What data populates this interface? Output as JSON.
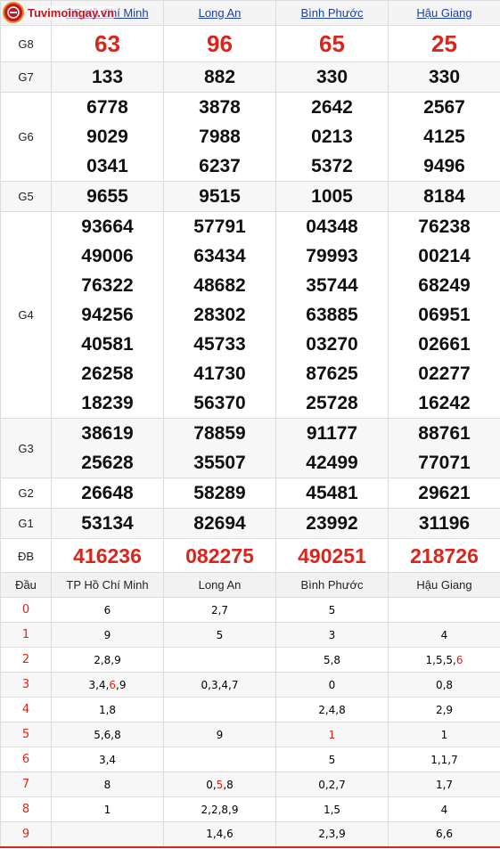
{
  "logo": {
    "text": "Tuvimoingay.vn"
  },
  "provinces": [
    "TP Hồ Chí Minh",
    "Long An",
    "Bình Phước",
    "Hậu Giang"
  ],
  "prizes": [
    {
      "label": "G8",
      "values": [
        [
          "63"
        ],
        [
          "96"
        ],
        [
          "65"
        ],
        [
          "25"
        ]
      ]
    },
    {
      "label": "G7",
      "values": [
        [
          "133"
        ],
        [
          "882"
        ],
        [
          "330"
        ],
        [
          "330"
        ]
      ]
    },
    {
      "label": "G6",
      "values": [
        [
          "6778",
          "9029",
          "0341"
        ],
        [
          "3878",
          "7988",
          "6237"
        ],
        [
          "2642",
          "0213",
          "5372"
        ],
        [
          "2567",
          "4125",
          "9496"
        ]
      ]
    },
    {
      "label": "G5",
      "values": [
        [
          "9655"
        ],
        [
          "9515"
        ],
        [
          "1005"
        ],
        [
          "8184"
        ]
      ]
    },
    {
      "label": "G4",
      "values": [
        [
          "93664",
          "49006",
          "76322",
          "94256",
          "40581",
          "26258",
          "18239"
        ],
        [
          "57791",
          "63434",
          "48682",
          "28302",
          "45733",
          "41730",
          "56370"
        ],
        [
          "04348",
          "79993",
          "35744",
          "63885",
          "03270",
          "87625",
          "25728"
        ],
        [
          "76238",
          "00214",
          "68249",
          "06951",
          "02661",
          "02277",
          "16242"
        ]
      ]
    },
    {
      "label": "G3",
      "values": [
        [
          "38619",
          "25628"
        ],
        [
          "78859",
          "35507"
        ],
        [
          "91177",
          "42499"
        ],
        [
          "88761",
          "77071"
        ]
      ]
    },
    {
      "label": "G2",
      "values": [
        [
          "26648"
        ],
        [
          "58289"
        ],
        [
          "45481"
        ],
        [
          "29621"
        ]
      ]
    },
    {
      "label": "G1",
      "values": [
        [
          "53134"
        ],
        [
          "82694"
        ],
        [
          "23992"
        ],
        [
          "31196"
        ]
      ]
    },
    {
      "label": "ĐB",
      "values": [
        [
          "416236"
        ],
        [
          "082275"
        ],
        [
          "490251"
        ],
        [
          "218726"
        ]
      ]
    }
  ],
  "loto": {
    "header": {
      "dau": "Đầu",
      "provinces": [
        "TP Hồ Chí Minh",
        "Long An",
        "Bình Phước",
        "Hậu Giang"
      ]
    },
    "rows": [
      {
        "dau": "0",
        "cells": [
          [
            {
              "t": "6"
            }
          ],
          [
            {
              "t": "2,7"
            }
          ],
          [
            {
              "t": "5"
            }
          ],
          []
        ]
      },
      {
        "dau": "1",
        "cells": [
          [
            {
              "t": "9"
            }
          ],
          [
            {
              "t": "5"
            }
          ],
          [
            {
              "t": "3"
            }
          ],
          [
            {
              "t": "4"
            }
          ]
        ]
      },
      {
        "dau": "2",
        "cells": [
          [
            {
              "t": "2,8,9"
            }
          ],
          [],
          [
            {
              "t": "5,8"
            }
          ],
          [
            {
              "t": "1,5,5,"
            },
            {
              "t": "6",
              "hl": true
            }
          ]
        ]
      },
      {
        "dau": "3",
        "cells": [
          [
            {
              "t": "3,4,"
            },
            {
              "t": "6",
              "hl": true
            },
            {
              "t": ",9"
            }
          ],
          [
            {
              "t": "0,3,4,7"
            }
          ],
          [
            {
              "t": "0"
            }
          ],
          [
            {
              "t": "0,8"
            }
          ]
        ]
      },
      {
        "dau": "4",
        "cells": [
          [
            {
              "t": "1,8"
            }
          ],
          [],
          [
            {
              "t": "2,4,8"
            }
          ],
          [
            {
              "t": "2,9"
            }
          ]
        ]
      },
      {
        "dau": "5",
        "cells": [
          [
            {
              "t": "5,6,8"
            }
          ],
          [
            {
              "t": "9"
            }
          ],
          [
            {
              "t": "1",
              "hl": true
            }
          ],
          [
            {
              "t": "1"
            }
          ]
        ]
      },
      {
        "dau": "6",
        "cells": [
          [
            {
              "t": "3,4"
            }
          ],
          [],
          [
            {
              "t": "5"
            }
          ],
          [
            {
              "t": "1,1,7"
            }
          ]
        ]
      },
      {
        "dau": "7",
        "cells": [
          [
            {
              "t": "8"
            }
          ],
          [
            {
              "t": "0,"
            },
            {
              "t": "5",
              "hl": true
            },
            {
              "t": ",8"
            }
          ],
          [
            {
              "t": "0,2,7"
            }
          ],
          [
            {
              "t": "1,7"
            }
          ]
        ]
      },
      {
        "dau": "8",
        "cells": [
          [
            {
              "t": "1"
            }
          ],
          [
            {
              "t": "2,2,8,9"
            }
          ],
          [
            {
              "t": "1,5"
            }
          ],
          [
            {
              "t": "4"
            }
          ]
        ]
      },
      {
        "dau": "9",
        "cells": [
          [],
          [
            {
              "t": "1,4,6"
            }
          ],
          [
            {
              "t": "2,3,9"
            }
          ],
          [
            {
              "t": "6,6"
            }
          ]
        ]
      }
    ]
  },
  "colors": {
    "accent_red": "#d9261c",
    "link_blue": "#1a3fa8"
  }
}
